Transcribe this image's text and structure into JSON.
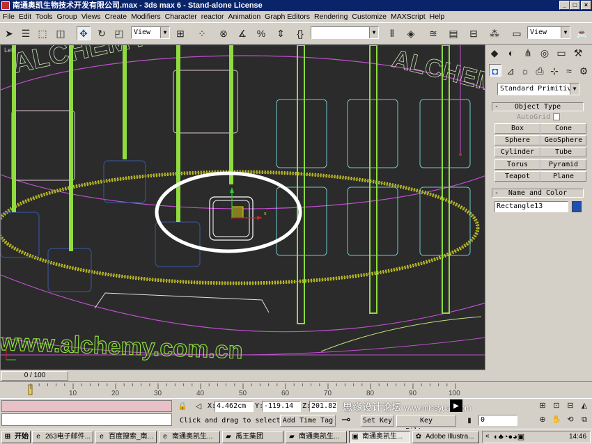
{
  "window": {
    "title": "南通奥凯生物技术开发有限公司.max - 3ds max 6 - Stand-alone License"
  },
  "menu": [
    "File",
    "Edit",
    "Tools",
    "Group",
    "Views",
    "Create",
    "Modifiers",
    "Character",
    "reactor",
    "Animation",
    "Graph Editors",
    "Rendering",
    "Customize",
    "MAXScript",
    "Help"
  ],
  "toolbar": {
    "view_dropdown_1": "View",
    "view_dropdown_2": "View",
    "selection_set": ""
  },
  "viewport": {
    "label": "Left",
    "watermark_text": "www.alchemy.com.cn",
    "arc_text": "ALCHEMY"
  },
  "command_panel": {
    "category": "Standard Primitiv",
    "object_type_title": "Object Type",
    "autogrid_label": "AutoGrid",
    "buttons": [
      "Box",
      "Cone",
      "Sphere",
      "GeoSphere",
      "Cylinder",
      "Tube",
      "Torus",
      "Pyramid",
      "Teapot",
      "Plane"
    ],
    "name_color_title": "Name and Color",
    "object_name": "Rectangle13",
    "object_color": "#1f4fb0"
  },
  "timeline": {
    "frame_display": "0 / 100",
    "ticks": [
      "10",
      "20",
      "30",
      "40",
      "50",
      "60",
      "70",
      "80",
      "90",
      "100"
    ]
  },
  "status": {
    "x_label": "X:",
    "x_value": "4.462cm",
    "y_label": "Y:",
    "y_value": "-119.14",
    "z_label": "Z:",
    "z_value": "201.82",
    "prompt": "Click and drag to select",
    "add_time_tag": "Add Time Tag",
    "set_key": "Set Key",
    "key_filters": "Key Filters...",
    "frame_field": "0",
    "overlay_watermark": "思缘设计论坛",
    "overlay_url": "www.missyuan.com"
  },
  "taskbar": {
    "start": "开始",
    "tasks": [
      "263电子邮件...",
      "百度搜索_南...",
      "南通奥凯生...",
      "禹王集团",
      "南通奥凯生...",
      "南通奥凯生...",
      "Adobe Illustra..."
    ],
    "clock": "14:46"
  },
  "colors": {
    "green": "#8fdc40",
    "magenta": "#c050d0",
    "cyan": "#70c8d0",
    "blue": "#3a5aa8",
    "yellow": "#c8c828",
    "titlebar": "#0a246a"
  }
}
